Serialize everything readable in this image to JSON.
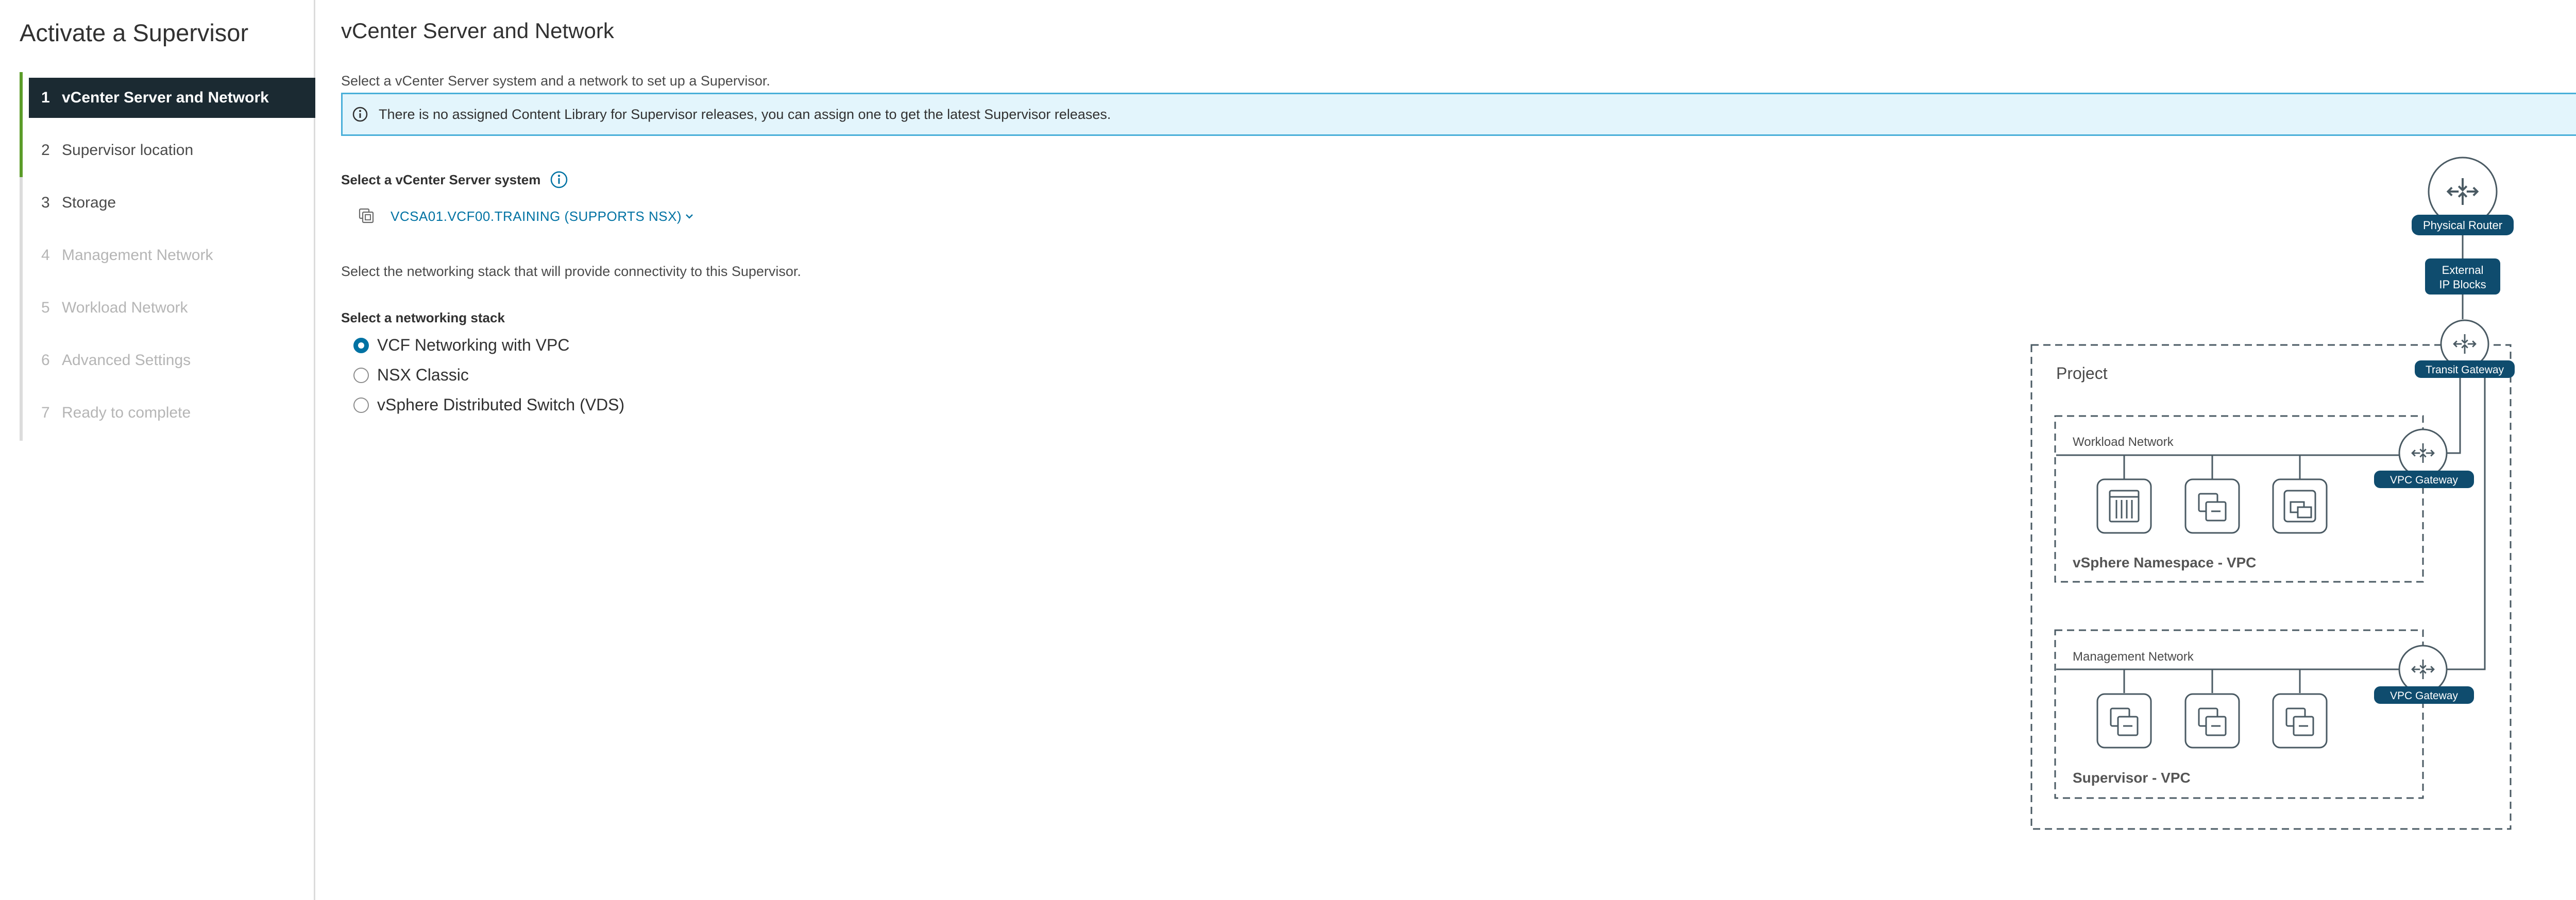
{
  "wizard": {
    "title": "Activate a Supervisor",
    "steps": [
      {
        "num": "1",
        "label": "vCenter Server and Network",
        "state": "active"
      },
      {
        "num": "2",
        "label": "Supervisor location",
        "state": "enabled"
      },
      {
        "num": "3",
        "label": "Storage",
        "state": "enabled"
      },
      {
        "num": "4",
        "label": "Management Network",
        "state": "disabled"
      },
      {
        "num": "5",
        "label": "Workload Network",
        "state": "disabled"
      },
      {
        "num": "6",
        "label": "Advanced Settings",
        "state": "disabled"
      },
      {
        "num": "7",
        "label": "Ready to complete",
        "state": "disabled"
      }
    ]
  },
  "main": {
    "title": "vCenter Server and Network",
    "subtitle": "Select a vCenter Server system and a network to set up a Supervisor.",
    "alert": "There is no assigned Content Library for Supervisor releases, you can assign one to get the latest Supervisor releases.",
    "vcenter_label": "Select a vCenter Server system",
    "vcenter_value": "VCSA01.VCF00.TRAINING (SUPPORTS NSX)",
    "stack_description": "Select the networking stack that will provide connectivity to this Supervisor.",
    "stack_label": "Select a networking stack",
    "stack_options": [
      {
        "label": "VCF Networking with VPC",
        "selected": true
      },
      {
        "label": "NSX Classic",
        "selected": false
      },
      {
        "label": "vSphere Distributed Switch (VDS)",
        "selected": false
      }
    ]
  },
  "diagram": {
    "physical_router": "Physical Router",
    "external_ip_line1": "External",
    "external_ip_line2": "IP Blocks",
    "transit_gateway": "Transit Gateway",
    "project": "Project",
    "workload_network": "Workload Network",
    "vpc_gateway_1": "VPC Gateway",
    "namespace_vpc": "vSphere Namespace - VPC",
    "management_network": "Management Network",
    "vpc_gateway_2": "VPC Gateway",
    "supervisor_vpc": "Supervisor - VPC"
  },
  "colors": {
    "active_step_bg": "#1b2a32",
    "completed_bar": "#5b9c29",
    "link_blue": "#0072a3",
    "alert_bg": "#e3f5fc",
    "alert_border": "#49afd9",
    "diagram_badge": "#0f4c6e"
  }
}
